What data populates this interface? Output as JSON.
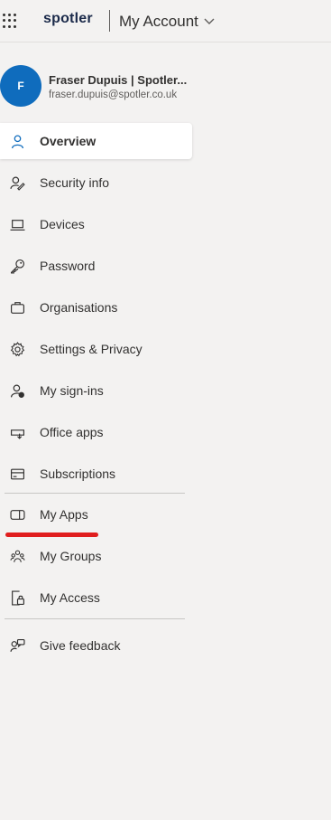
{
  "header": {
    "brand": "spotler",
    "title": "My Account"
  },
  "profile": {
    "initial": "F",
    "name": "Fraser Dupuis | Spotler...",
    "email": "fraser.dupuis@spotler.co.uk"
  },
  "nav": {
    "group1": [
      {
        "label": "Overview",
        "icon": "person-icon",
        "active": true
      },
      {
        "label": "Security info",
        "icon": "security-info-icon"
      },
      {
        "label": "Devices",
        "icon": "laptop-icon"
      },
      {
        "label": "Password",
        "icon": "key-icon"
      },
      {
        "label": "Organisations",
        "icon": "briefcase-icon"
      },
      {
        "label": "Settings & Privacy",
        "icon": "gear-icon"
      },
      {
        "label": "My sign-ins",
        "icon": "sign-ins-icon"
      },
      {
        "label": "Office apps",
        "icon": "office-apps-icon"
      },
      {
        "label": "Subscriptions",
        "icon": "card-icon"
      }
    ],
    "group2": [
      {
        "label": "My Apps",
        "icon": "apps-icon"
      },
      {
        "label": "My Groups",
        "icon": "groups-icon"
      },
      {
        "label": "My Access",
        "icon": "access-icon"
      }
    ],
    "group3": [
      {
        "label": "Give feedback",
        "icon": "feedback-icon"
      }
    ]
  },
  "colors": {
    "accent": "#0f6cbd",
    "annotation": "#e01e1e"
  }
}
